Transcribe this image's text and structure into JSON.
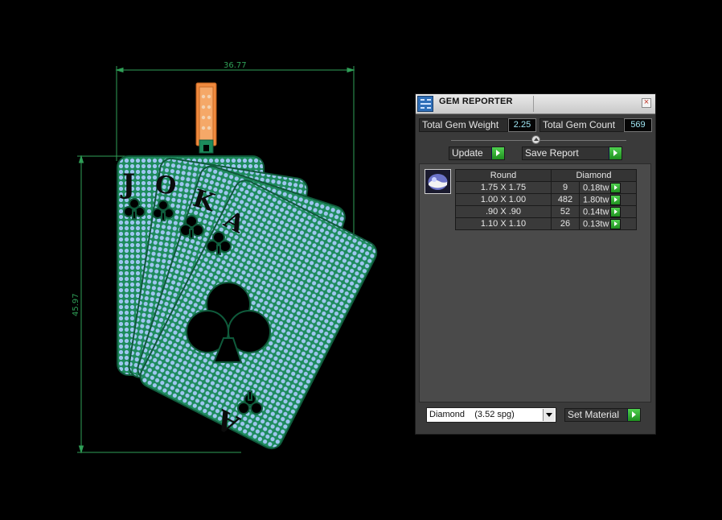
{
  "drawing": {
    "width_dimension": "36.77",
    "height_dimension": "45.97",
    "card_letters": [
      "J",
      "O",
      "K",
      "A"
    ],
    "colors": {
      "metal": "#1d8b5c",
      "pave": "#9ec6f0",
      "bail": "#f08a3e",
      "dimension": "#2f9f57"
    }
  },
  "gem_reporter": {
    "title": "GEM REPORTER",
    "total_gem_weight_label": "Total Gem Weight",
    "total_gem_weight": "2.25",
    "total_gem_count_label": "Total Gem Count",
    "total_gem_count": "569",
    "update_label": "Update",
    "save_report_label": "Save Report",
    "table": {
      "headers": [
        "Round",
        "Diamond"
      ],
      "rows": [
        {
          "size": "1.75 X 1.75",
          "count": "9",
          "weight": "0.18tw"
        },
        {
          "size": "1.00 X 1.00",
          "count": "482",
          "weight": "1.80tw"
        },
        {
          "size": ".90 X .90",
          "count": "52",
          "weight": "0.14tw"
        },
        {
          "size": "1.10 X 1.10",
          "count": "26",
          "weight": "0.13tw"
        }
      ]
    },
    "material_value": "Diamond    (3.52 spg)",
    "set_material_label": "Set Material",
    "icons": [
      "gem-reporter-app-icon",
      "close-icon",
      "play-icon",
      "dropdown-arrow-icon",
      "gem-icon"
    ]
  }
}
